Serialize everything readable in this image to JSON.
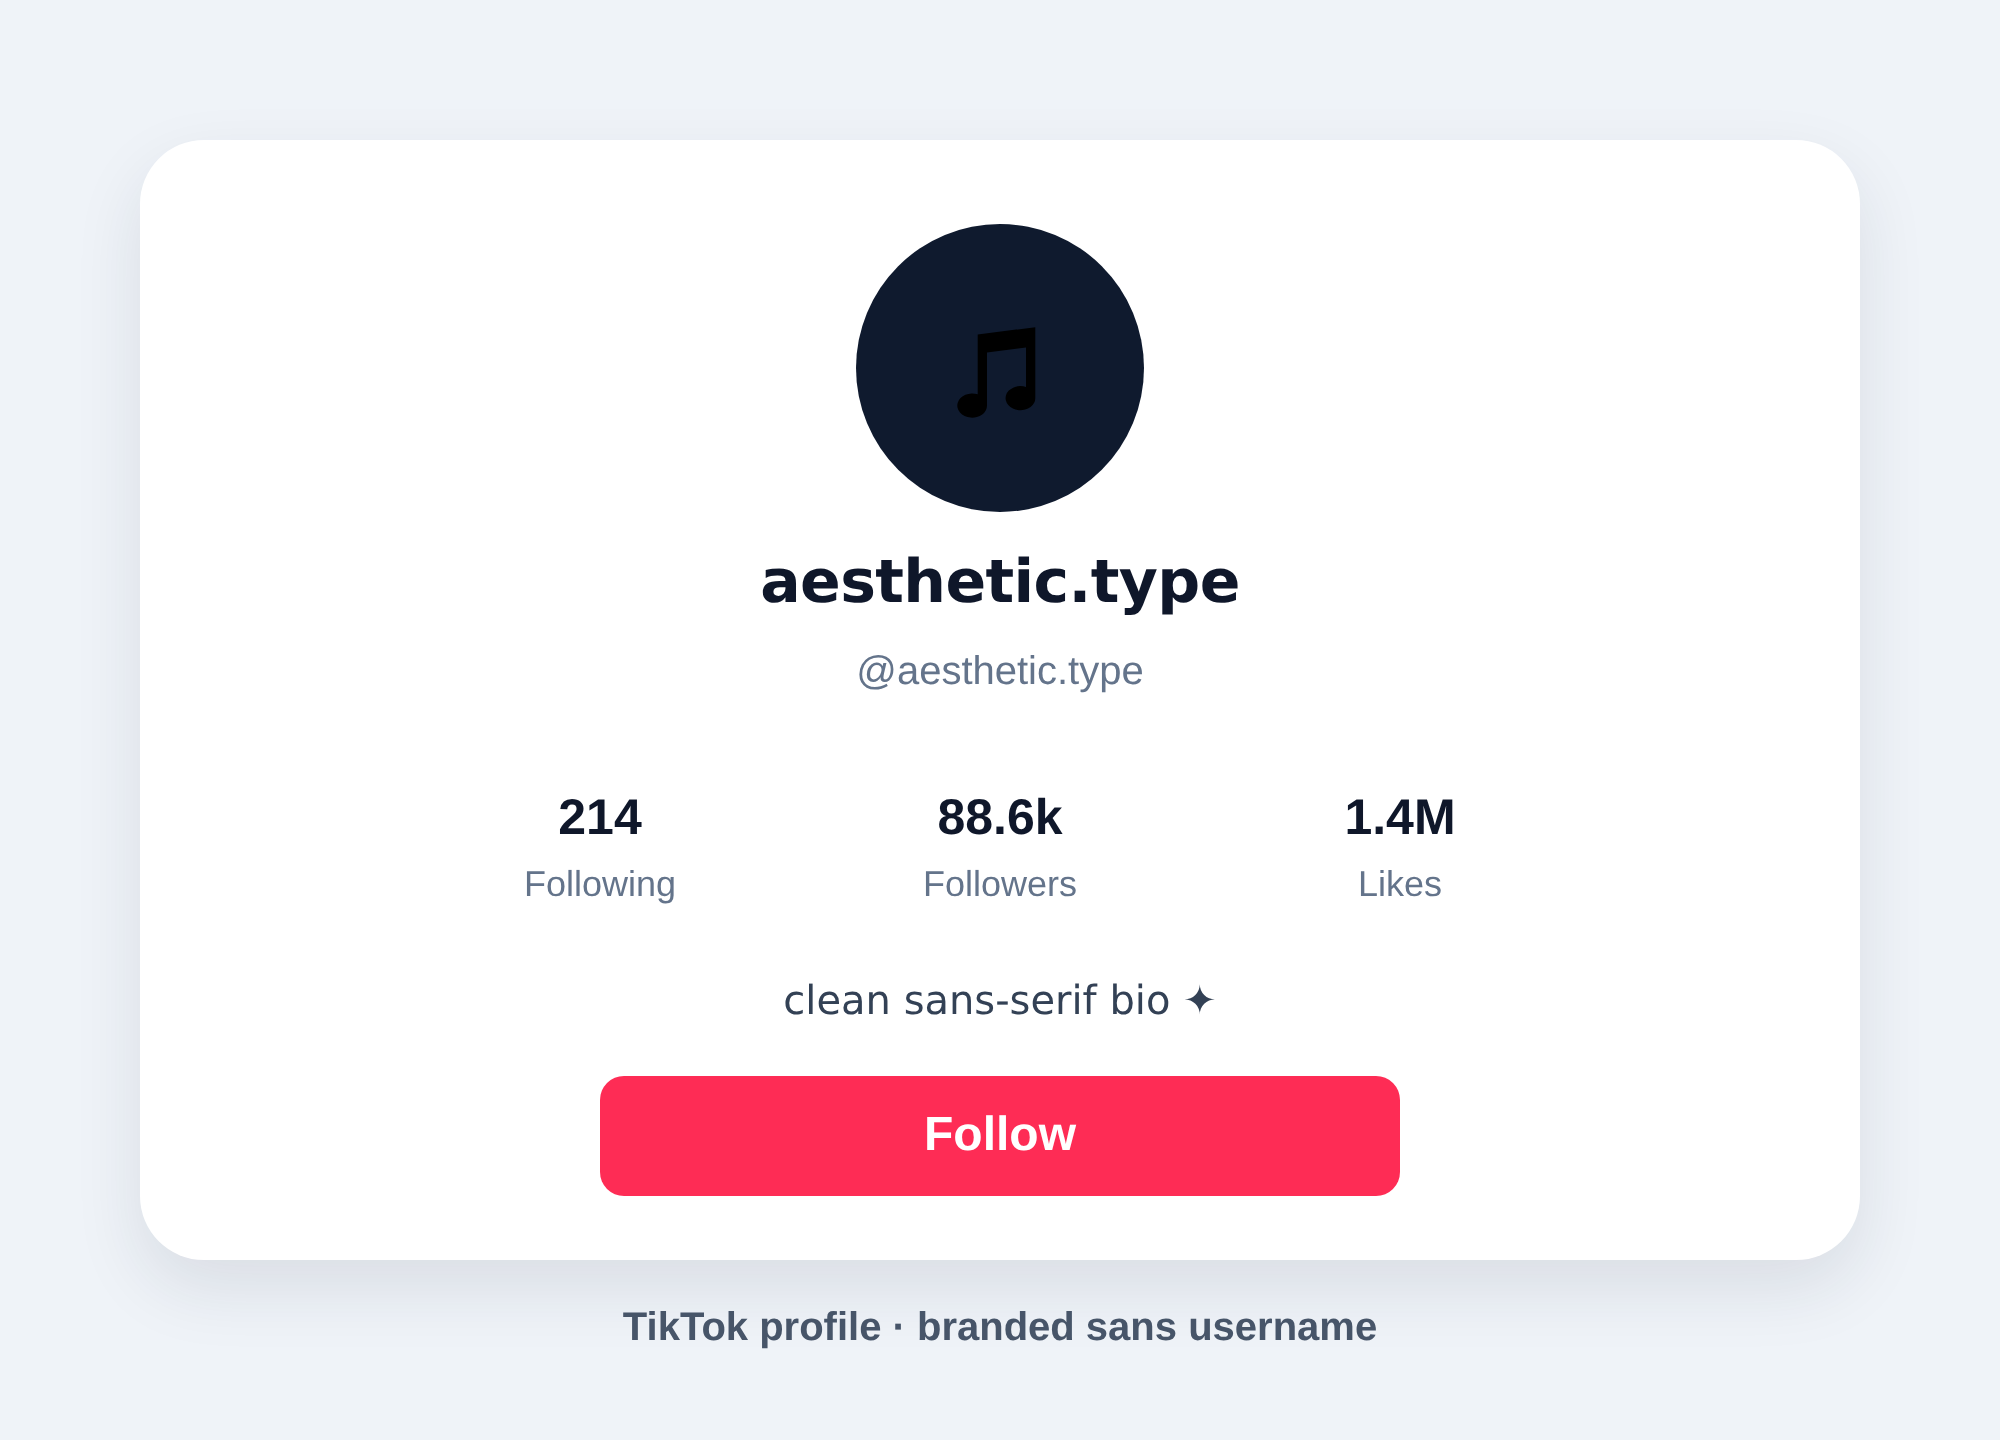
{
  "profile": {
    "display_name": "aesthetic.type",
    "handle": "@aesthetic.type",
    "stats": [
      {
        "value": "214",
        "label": "Following"
      },
      {
        "value": "88.6k",
        "label": "Followers"
      },
      {
        "value": "1.4M",
        "label": "Likes"
      }
    ],
    "bio": "clean sans-serif bio ✦",
    "follow_button": "Follow"
  },
  "caption": "TikTok profile · branded sans username"
}
